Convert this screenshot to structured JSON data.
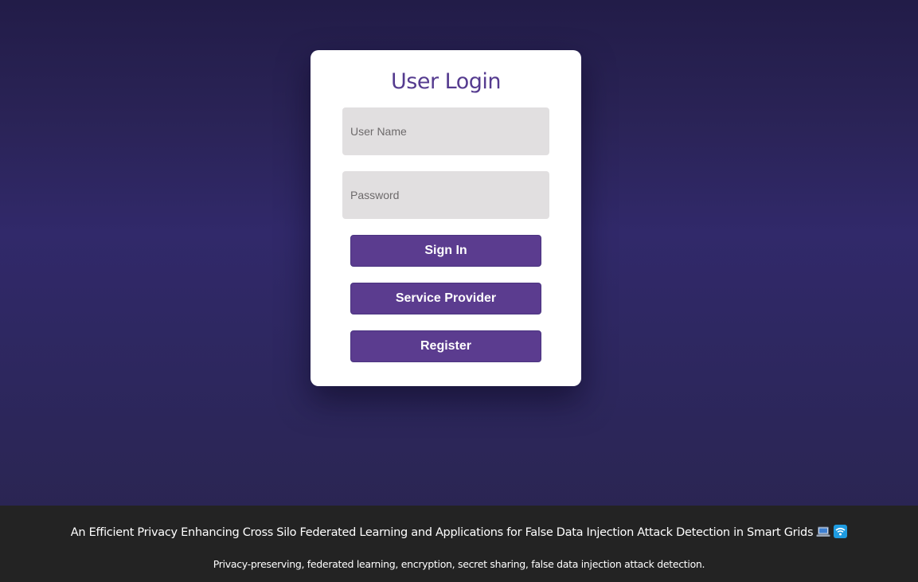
{
  "login": {
    "title": "User Login",
    "username_placeholder": "User Name",
    "password_placeholder": "Password",
    "sign_in_label": "Sign In",
    "service_provider_label": "Service Provider",
    "register_label": "Register"
  },
  "footer": {
    "title": "An Efficient Privacy Enhancing Cross Silo Federated Learning and Applications for False Data Injection Attack Detection in Smart Grids",
    "icons": [
      "laptop-icon",
      "wifi-icon"
    ],
    "subtitle": "Privacy-preserving, federated learning, encryption, secret sharing, false data injection attack detection."
  },
  "colors": {
    "accent": "#5b3c8f",
    "title": "#553b8f",
    "input_bg": "#e1dfe0",
    "footer_bg": "#232323"
  }
}
